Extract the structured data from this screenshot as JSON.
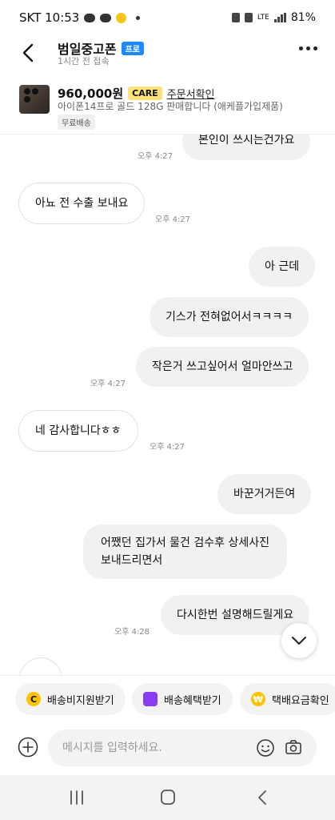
{
  "status_bar": {
    "carrier_time": "SKT 10:53",
    "network": "LTE",
    "battery": "81%"
  },
  "header": {
    "seller_name": "범일중고폰",
    "pro_badge": "프로",
    "last_seen": "1시간 전 접속"
  },
  "product": {
    "price": "960,000원",
    "care_badge": "CARE",
    "order_link": "주문서확인",
    "description": "아이폰14프로 골드 128G 판매합니다 (애케플가입제품)",
    "shipping_tag": "무료배송"
  },
  "messages": [
    {
      "from": "me",
      "text": "본인이 쓰시는건가요",
      "time": "오후 4:27"
    },
    {
      "from": "other",
      "text": "아뇨 전 수출 보내요",
      "time": "오후 4:27"
    },
    {
      "from": "me",
      "text": "아 근데",
      "time": ""
    },
    {
      "from": "me",
      "text": "기스가 전혀없어서ㅋㅋㅋㅋ",
      "time": ""
    },
    {
      "from": "me",
      "text": "작은거 쓰고싶어서 얼마안쓰고",
      "time": "오후 4:27"
    },
    {
      "from": "other",
      "text": "네 감사합니다ㅎㅎ",
      "time": "오후 4:27"
    },
    {
      "from": "me",
      "text": "바꾼거거든여",
      "time": ""
    },
    {
      "from": "me",
      "text_line1": "어쨌던 집가서 물건 검수후 상세사진",
      "text_line2": "보내드리면서",
      "time": ""
    },
    {
      "from": "me",
      "text": "다시한번 설명해드릴게요",
      "time": "오후 4:28"
    }
  ],
  "quick_actions": [
    {
      "label": "배송비지원받기",
      "icon": "c-coin-icon",
      "color": "#ffc400"
    },
    {
      "label": "배송혜택받기",
      "icon": "gift-icon",
      "color": "#8b3df0"
    },
    {
      "label": "택배요금확인",
      "icon": "won-coin-icon",
      "color": "#ffc400"
    }
  ],
  "input": {
    "placeholder": "메시지를 입력하세요."
  },
  "colors": {
    "pro_badge": "#1e88ff",
    "care_badge": "#ffe27a",
    "my_bubble": "#f1f1f1"
  }
}
